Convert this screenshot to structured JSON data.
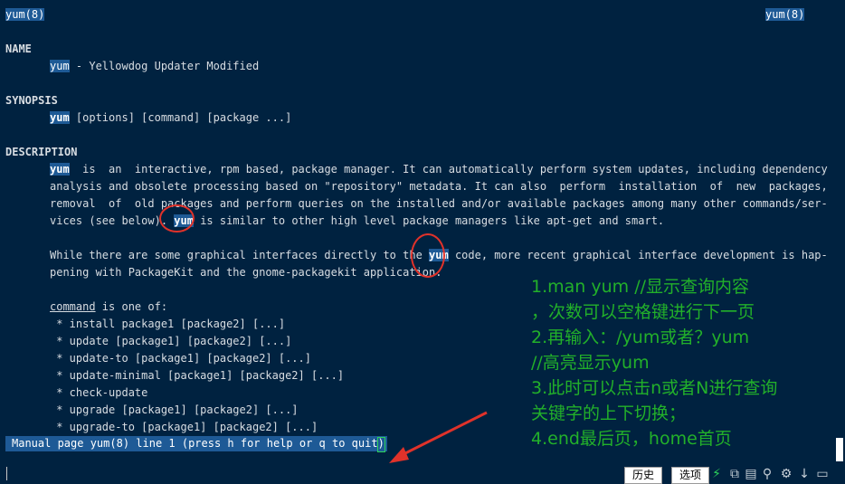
{
  "header": {
    "left": "yum(8)",
    "right": "yum(8)"
  },
  "name_section": {
    "heading": "NAME",
    "cmd": "yum",
    "desc": " - Yellowdog Updater Modified"
  },
  "synopsis": {
    "heading": "SYNOPSIS",
    "cmd": "yum",
    "args": " [options] [command] [package ...]"
  },
  "description": {
    "heading": "DESCRIPTION",
    "p1_l1_cmd": "yum",
    "p1_l1": "  is  an  interactive, rpm based, package manager. It can automatically perform system updates, including dependency",
    "p1_l2": "analysis and obsolete processing based on \"repository\" metadata. It can also  perform  installation  of  new  packages,",
    "p1_l3": "removal  of  old packages and perform queries on the installed and/or available packages among many other commands/ser-",
    "p1_l4_pre": "vices (see below). ",
    "p1_l4_cmd": "yum",
    "p1_l4_post": " is similar to other high level package managers like apt-get and smart.",
    "p2_l1_pre": "While there are some graphical interfaces directly to the ",
    "p2_l1_cmd": "yum",
    "p2_l1_post": " code, more recent graphical interface development is hap-",
    "p2_l2": "pening with PackageKit and the gnome-packagekit application."
  },
  "commands": {
    "word": "command",
    "rest": " is one of:",
    "items": [
      " * install package1 [package2] [...]",
      " * update [package1] [package2] [...]",
      " * update-to [package1] [package2] [...]",
      " * update-minimal [package1] [package2] [...]",
      " * check-update",
      " * upgrade [package1] [package2] [...]",
      " * upgrade-to [package1] [package2] [...]"
    ]
  },
  "status_line": "Manual page yum(8) line 1 (press h for help or q to quit)",
  "annotation": [
    "1.man yum  //显示查询内容",
    "，次数可以空格键进行下一页",
    "2.再输入：/yum或者？yum",
    "//高亮显示yum",
    "3.此时可以点击n或者N进行查询",
    "关键字的上下切换；",
    "4.end最后页，home首页"
  ],
  "toolbar": {
    "history_label": "历史",
    "select_label": "选项",
    "icons": [
      "lightning-icon",
      "copy-icon",
      "clipboard-icon",
      "search-icon",
      "gear-icon",
      "download-icon",
      "maximize-icon"
    ]
  },
  "colors": {
    "background": "#002240",
    "highlight": "#1e5a96",
    "annotation": "#22b02a",
    "circle": "#e0322a"
  }
}
